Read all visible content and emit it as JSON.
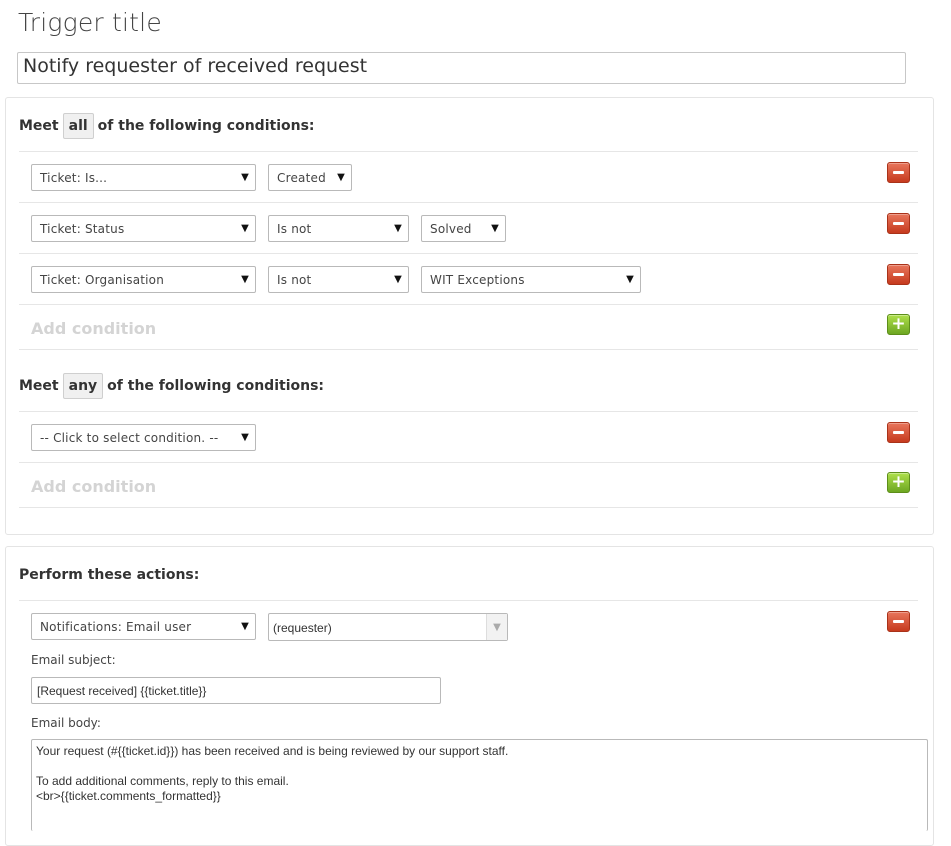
{
  "trigger": {
    "title_label": "Trigger title",
    "title_value": "Notify requester of received request"
  },
  "all_conditions": {
    "meet_prefix": "Meet",
    "qualifier": "all",
    "meet_suffix": "of the following conditions:",
    "rows": [
      {
        "field": "Ticket: Is...",
        "operator": "Created"
      },
      {
        "field": "Ticket: Status",
        "operator": "Is not",
        "value": "Solved"
      },
      {
        "field": "Ticket: Organisation",
        "operator": "Is not",
        "value": "WIT Exceptions"
      }
    ],
    "add_label": "Add condition"
  },
  "any_conditions": {
    "meet_prefix": "Meet",
    "qualifier": "any",
    "meet_suffix": "of the following conditions:",
    "rows": [
      {
        "field": "-- Click to select condition. --"
      }
    ],
    "add_label": "Add condition"
  },
  "actions": {
    "heading": "Perform these actions:",
    "action_field": "Notifications: Email user",
    "recipient": "(requester)",
    "subject_label": "Email subject:",
    "subject_value": "[Request received] {{ticket.title}}",
    "body_label": "Email body:",
    "body_lines": [
      "Your request (#{{ticket.id}}) has been received and is being reviewed by our support staff.",
      "",
      "To add additional comments, reply to this email.",
      "<br>{{ticket.comments_formatted}}"
    ]
  },
  "icons": {
    "dropdown": "chevron-down-icon",
    "remove": "minus-icon",
    "add": "plus-icon"
  },
  "colors": {
    "remove_button": "#c63a1e",
    "add_button": "#6da622"
  }
}
